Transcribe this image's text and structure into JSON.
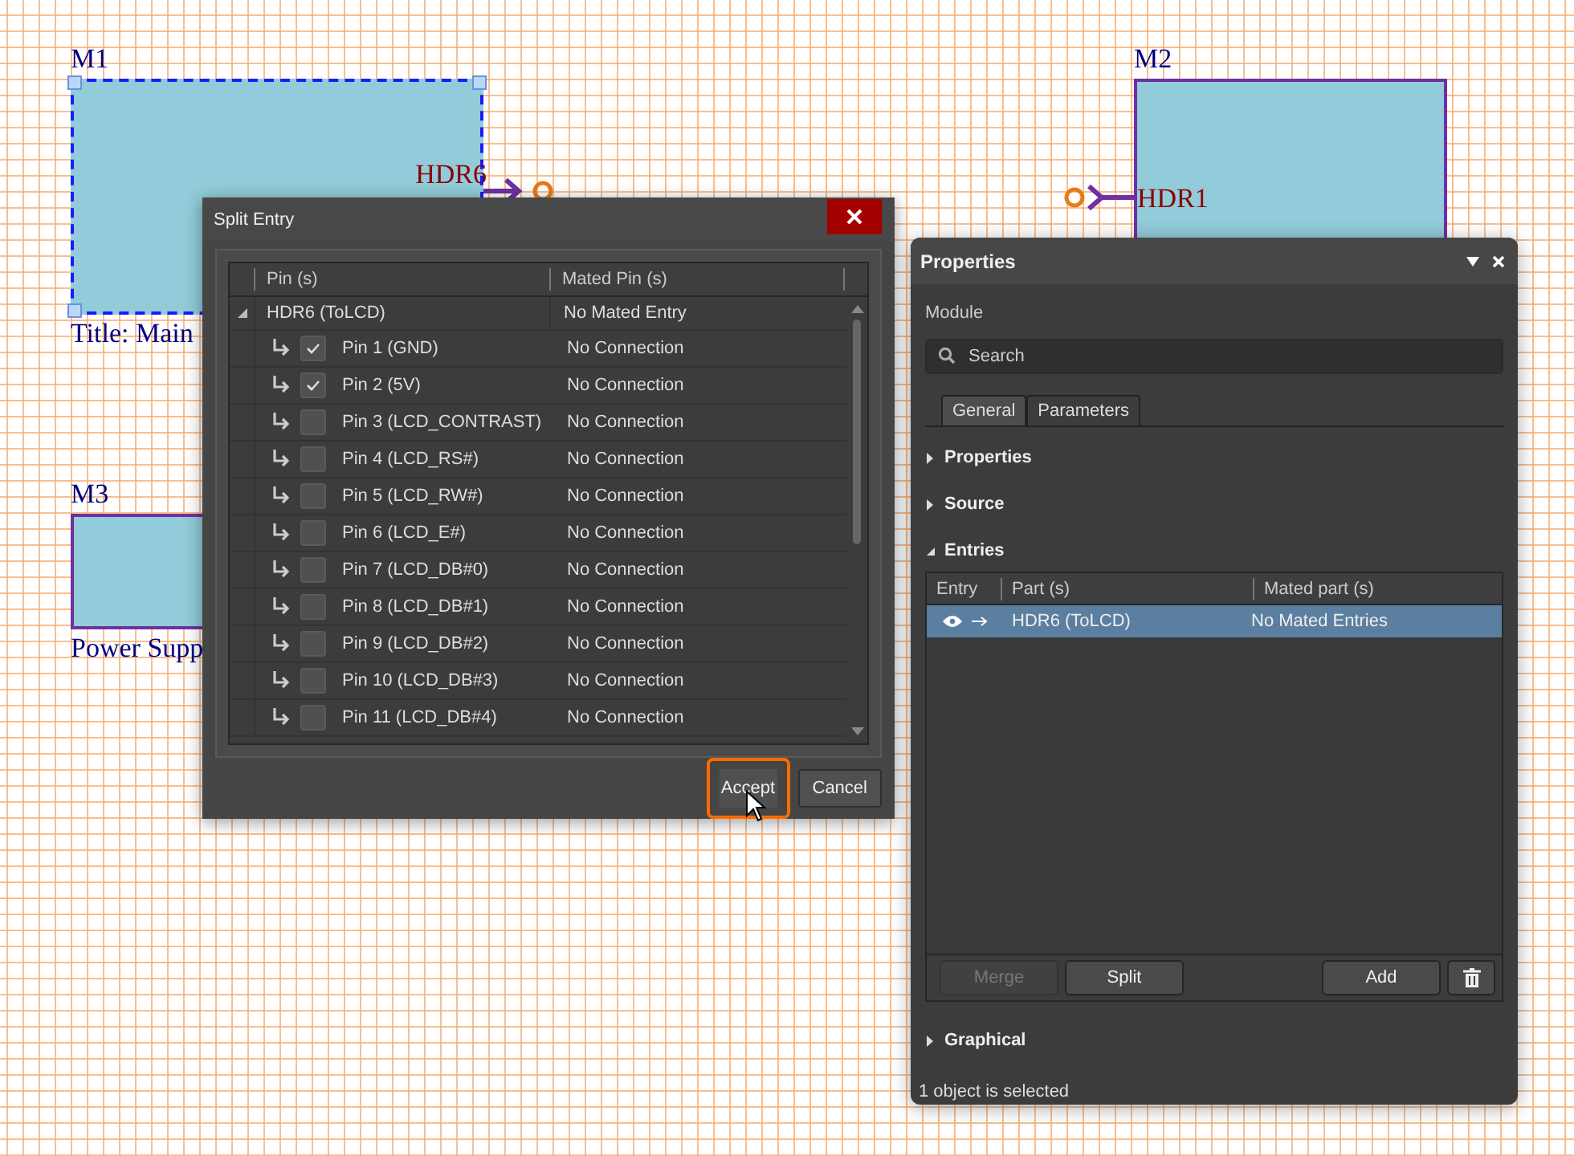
{
  "canvas": {
    "modules": [
      {
        "designator": "M1",
        "selected": true,
        "title": "Title: Main",
        "right_ports": [
          {
            "name": "HDR6"
          }
        ]
      },
      {
        "designator": "M2",
        "selected": false,
        "left_ports": [
          {
            "name": "HDR1"
          }
        ]
      },
      {
        "designator": "M3",
        "selected": false,
        "title": "Power Supp"
      }
    ]
  },
  "dialog": {
    "title": "Split Entry",
    "columns": [
      "Pin (s)",
      "Mated Pin (s)"
    ],
    "group": {
      "name": "HDR6 (ToLCD)",
      "mated": "No Mated Entry",
      "expanded": true
    },
    "rows": [
      {
        "pin": "Pin 1 (GND)",
        "mated": "No Connection",
        "checked": true
      },
      {
        "pin": "Pin 2 (5V)",
        "mated": "No Connection",
        "checked": true
      },
      {
        "pin": "Pin 3 (LCD_CONTRAST)",
        "mated": "No Connection",
        "checked": false
      },
      {
        "pin": "Pin 4 (LCD_RS#)",
        "mated": "No Connection",
        "checked": false
      },
      {
        "pin": "Pin 5 (LCD_RW#)",
        "mated": "No Connection",
        "checked": false
      },
      {
        "pin": "Pin 6 (LCD_E#)",
        "mated": "No Connection",
        "checked": false
      },
      {
        "pin": "Pin 7 (LCD_DB#0)",
        "mated": "No Connection",
        "checked": false
      },
      {
        "pin": "Pin 8 (LCD_DB#1)",
        "mated": "No Connection",
        "checked": false
      },
      {
        "pin": "Pin 9 (LCD_DB#2)",
        "mated": "No Connection",
        "checked": false
      },
      {
        "pin": "Pin 10 (LCD_DB#3)",
        "mated": "No Connection",
        "checked": false
      },
      {
        "pin": "Pin 11 (LCD_DB#4)",
        "mated": "No Connection",
        "checked": false
      }
    ],
    "buttons": [
      {
        "label": "Accept",
        "highlighted": true
      },
      {
        "label": "Cancel",
        "highlighted": false
      }
    ]
  },
  "properties": {
    "title": "Properties",
    "object_type": "Module",
    "search": {
      "placeholder": "Search"
    },
    "tabs": [
      {
        "label": "General",
        "selected": true
      },
      {
        "label": "Parameters",
        "selected": false
      }
    ],
    "sections_before": [
      {
        "label": "Properties",
        "expanded": false
      },
      {
        "label": "Source",
        "expanded": false
      },
      {
        "label": "Entries",
        "expanded": true
      }
    ],
    "entries": {
      "columns": [
        "Entry",
        "Part (s)",
        "Mated part (s)"
      ],
      "rows": [
        {
          "part": "HDR6 (ToLCD)",
          "mated": "No Mated Entries",
          "selected": true
        }
      ],
      "buttons": [
        {
          "label": "Merge",
          "disabled": true
        },
        {
          "label": "Split",
          "disabled": false
        },
        {
          "label": "Add",
          "disabled": false
        }
      ]
    },
    "sections_after": [
      {
        "label": "Graphical",
        "expanded": false
      }
    ],
    "status": "1 object is selected"
  }
}
